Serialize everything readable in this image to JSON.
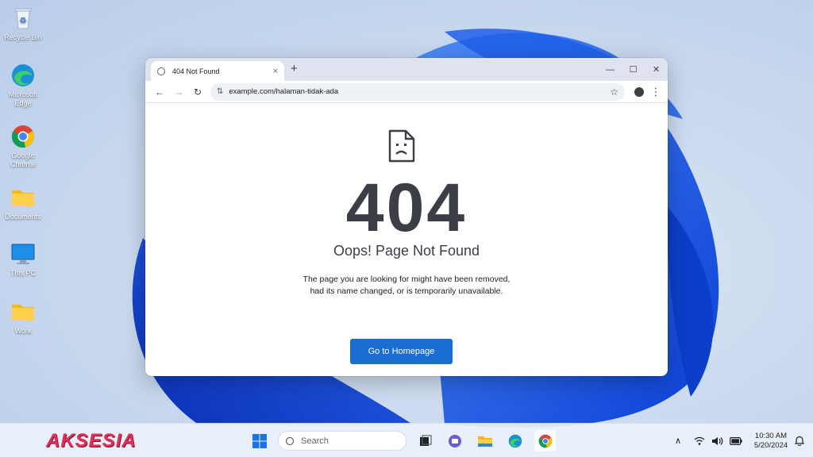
{
  "desktop": {
    "icons": [
      {
        "label": "Recycle Bin",
        "icon": "recycle-bin-icon"
      },
      {
        "label": "Microsoft Edge",
        "icon": "edge-icon"
      },
      {
        "label": "Google Chrome",
        "icon": "chrome-icon"
      },
      {
        "label": "Documents",
        "icon": "folder-icon"
      },
      {
        "label": "This PC",
        "icon": "monitor-icon"
      },
      {
        "label": "Work",
        "icon": "folder-icon"
      }
    ]
  },
  "browser": {
    "tab": {
      "title": "404 Not Found",
      "close": "×"
    },
    "new_tab": "+",
    "window_controls": {
      "minimize": "—",
      "maximize": "☐",
      "close": "✕"
    },
    "nav": {
      "back": "←",
      "forward": "→",
      "reload": "↻"
    },
    "url": "example.com/halaman-tidak-ada"
  },
  "page": {
    "code": "404",
    "title": "Oops! Page Not Found",
    "message_line1": "The page you are looking for might have been removed,",
    "message_line2": "had its name changed, or is temporarily unavailable.",
    "button": "Go to Homepage"
  },
  "taskbar": {
    "brand": "AKSESIA",
    "search_placeholder": "Search",
    "apps": [
      "task-view-icon",
      "teams-chat-icon",
      "file-explorer-icon",
      "edge-icon",
      "chrome-icon"
    ],
    "time": "10:30 AM",
    "date": "5/20/2024"
  },
  "colors": {
    "accent": "#1a6ed3",
    "heading": "#3b3f45",
    "tabbar": "#dee3ee"
  }
}
